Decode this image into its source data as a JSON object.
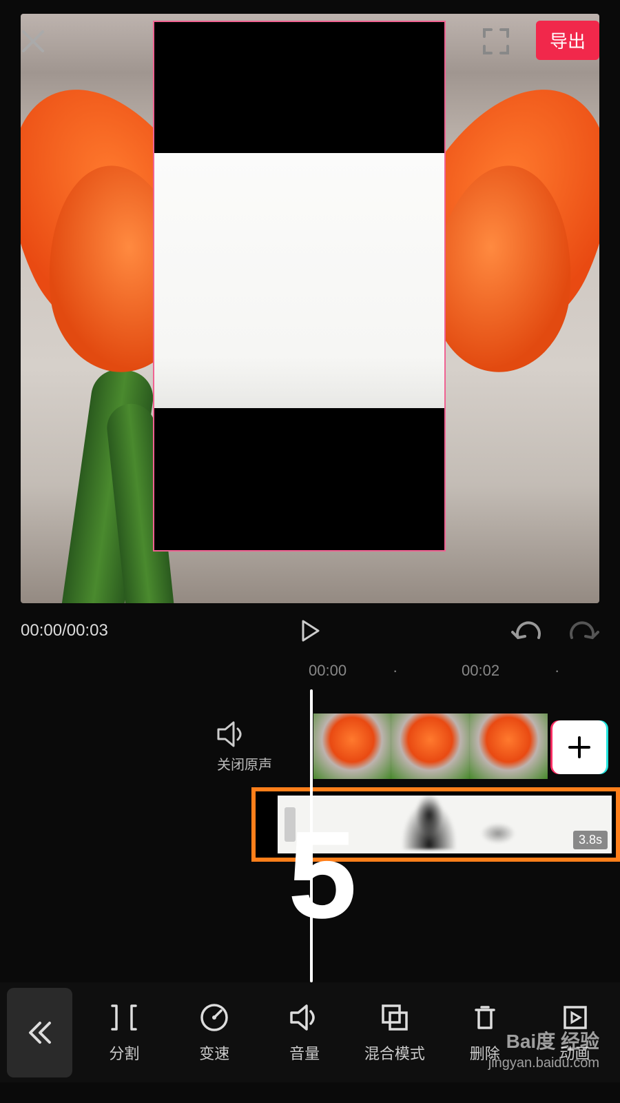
{
  "header": {
    "export_label": "导出"
  },
  "step_number": "5",
  "playback": {
    "time_display": "00:00/00:03"
  },
  "ruler": {
    "mark1": "00:00",
    "mark2": "00:02"
  },
  "timeline": {
    "mute_label": "关闭原声",
    "overlay_duration": "3.8s"
  },
  "tools": {
    "split": "分割",
    "speed": "变速",
    "volume": "音量",
    "blend": "混合模式",
    "delete": "删除",
    "animation": "动画"
  },
  "watermark": {
    "brand": "Bai度 经验",
    "url": "jingyan.baidu.com"
  }
}
